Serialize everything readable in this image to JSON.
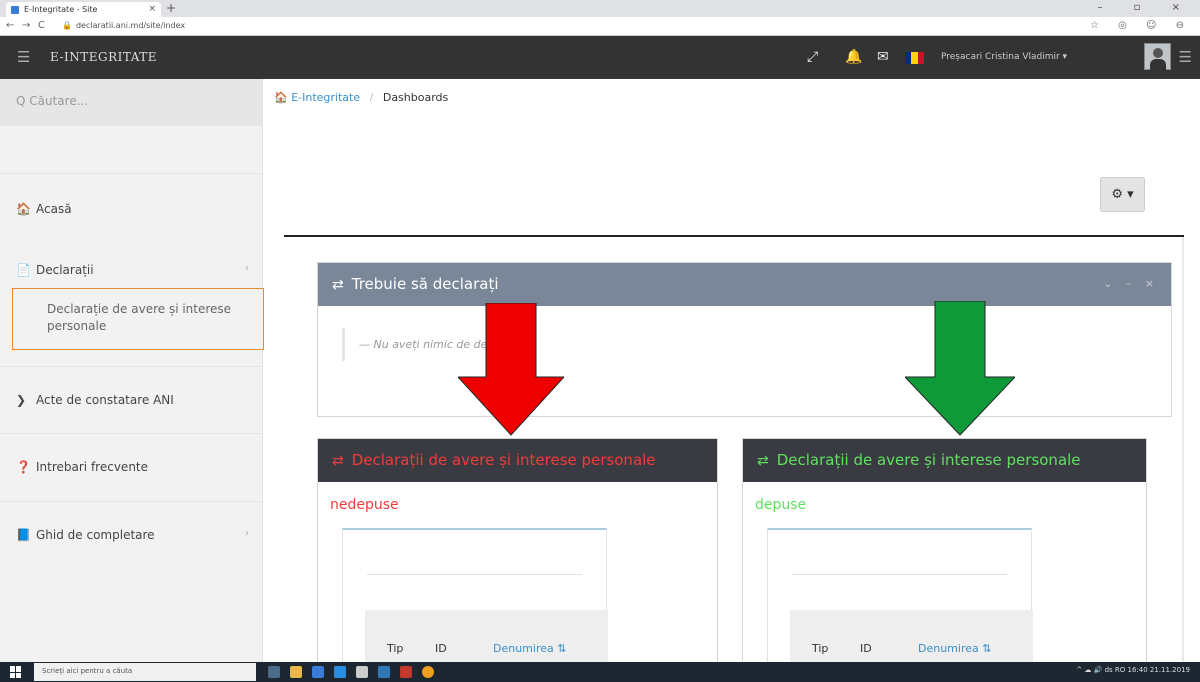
{
  "browser": {
    "tab_title": "E-Integritate - Site",
    "tab_close": "×",
    "new_tab": "+",
    "window_controls": "–  ▫  ×",
    "url": "declaratii.ani.md/site/index",
    "nav": {
      "back": "←",
      "forward": "→",
      "reload": "C"
    },
    "extensions": "☆ ◎ ☺ ⊖"
  },
  "header": {
    "menu_icon": "☰",
    "brand": "E-INTEGRITATE",
    "icons": {
      "tools": "⤢",
      "bell": "🔔",
      "mail": "✉"
    },
    "flag_colors": [
      "#002b7f",
      "#fcd116",
      "#ce1126"
    ],
    "user_name": "Preșacari Cristina Vladimir ▾",
    "right_menu_icon": "☰"
  },
  "sidebar": {
    "search_placeholder": "Q Căutare...",
    "items": [
      {
        "icon": "🏠",
        "label": "Acasă"
      },
      {
        "icon": "📄",
        "label": "Declarații",
        "chevron": "‹"
      },
      {
        "icon": "❯",
        "label": "Acte de constatare ANI"
      },
      {
        "icon": "❓",
        "label": "Intrebari frecvente"
      },
      {
        "icon": "📘",
        "label": "Ghid de completare",
        "chevron": "›"
      }
    ],
    "subitem": "Declarație de avere și interese personale"
  },
  "main": {
    "breadcrumb": {
      "home_icon": "🏠",
      "home": "E-Integritate",
      "sep": "/",
      "current": "Dashboards"
    },
    "settings_button": "⚙ ▾",
    "widget_todo": {
      "icon": "⇄",
      "title": "Trebuie să declarați",
      "tools": "⌄ – ×",
      "quote": "— Nu aveți nimic de declarat"
    },
    "widget_pending": {
      "icon": "⇄",
      "title": "Declarații de avere și interese personale",
      "status": "nedepuse",
      "col_tip": "Tip",
      "col_id": "ID",
      "col_name": "Denumirea ⇅"
    },
    "widget_submitted": {
      "icon": "⇄",
      "title": "Declarații de avere și interese personale",
      "status": "depuse",
      "col_tip": "Tip",
      "col_id": "ID",
      "col_name": "Denumirea ⇅"
    }
  },
  "colors": {
    "header_bg": "#333333",
    "widget_head": "#7a8799",
    "dark_head": "#3a3a42",
    "red": "#f23a3a",
    "green": "#5fe05f",
    "arrow_red": "#ee0000",
    "arrow_green": "#0f9a3a"
  },
  "taskbar": {
    "search_placeholder": "Scrieți aici pentru a căuta",
    "tray": "^ ☁ 🔊 ds RO  16:40  21.11.2019"
  }
}
